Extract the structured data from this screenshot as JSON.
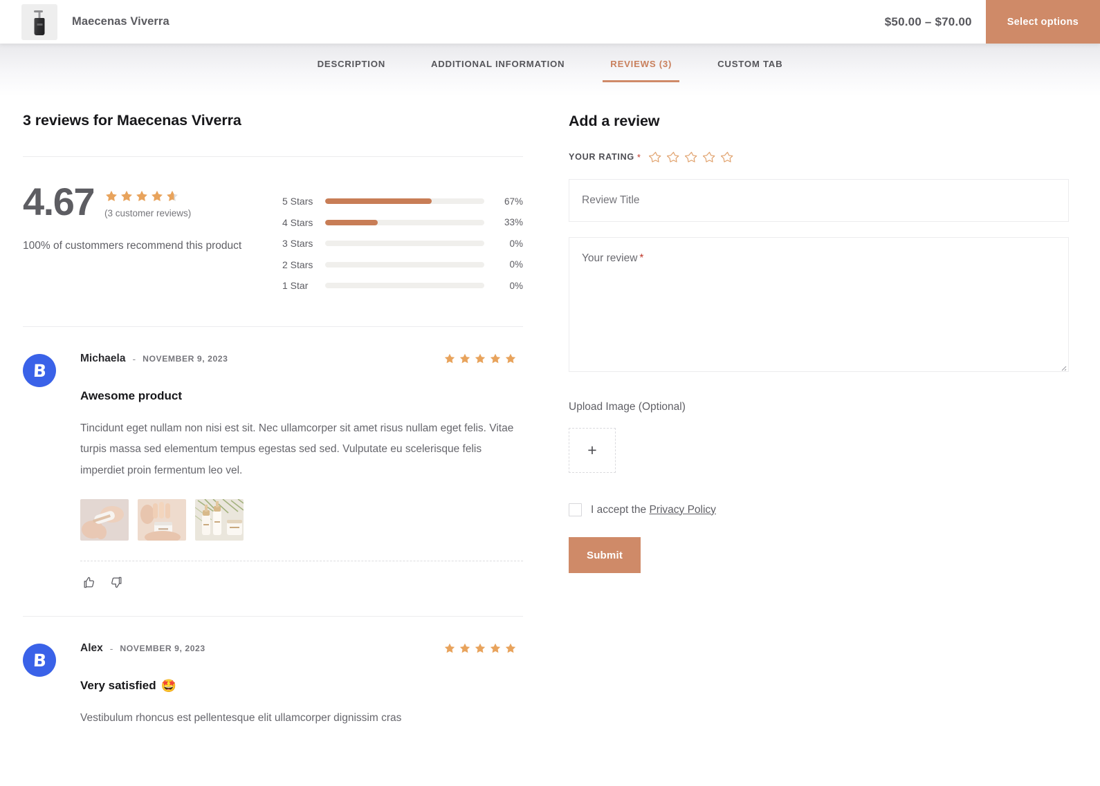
{
  "header": {
    "product_title": "Maecenas Viverra",
    "price_range": "$50.00 – $70.00",
    "select_options_label": "Select options",
    "thumbnail_icon": "product-bottle-image"
  },
  "tabs": [
    {
      "label": "DESCRIPTION",
      "active": false
    },
    {
      "label": "ADDITIONAL INFORMATION",
      "active": false
    },
    {
      "label": "REVIEWS (3)",
      "active": true
    },
    {
      "label": "CUSTOM TAB",
      "active": false
    }
  ],
  "reviews_panel": {
    "heading": "3 reviews for Maecenas Viverra",
    "summary": {
      "score": "4.67",
      "stars_filled": 4.67,
      "customer_reviews_note": "(3 customer reviews)",
      "recommend_text": "100% of custommers recommend this product"
    },
    "breakdown": [
      {
        "label": "5 Stars",
        "pct_text": "67%",
        "pct": 67
      },
      {
        "label": "4 Stars",
        "pct_text": "33%",
        "pct": 33
      },
      {
        "label": "3 Stars",
        "pct_text": "0%",
        "pct": 0
      },
      {
        "label": "2 Stars",
        "pct_text": "0%",
        "pct": 0
      },
      {
        "label": "1 Star",
        "pct_text": "0%",
        "pct": 0
      }
    ],
    "reviews": [
      {
        "author": "Michaela",
        "separator": "-",
        "date": "NOVEMBER 9, 2023",
        "rating": 5,
        "title": "Awesome product",
        "emoji": "",
        "text": "Tincidunt eget nullam non nisi est sit. Nec ullamcorper sit amet risus nullam eget felis. Vitae turpis massa sed elementum tempus egestas sed sed. Vulputate eu scelerisque felis imperdiet proin fermentum leo vel.",
        "photos": [
          "review-photo-hand-bottle",
          "review-photo-hand-jar",
          "review-photo-products-palm"
        ],
        "avatar_letter": "B",
        "avatar_color": "#3a62e8",
        "actions": [
          "thumbs-up-icon",
          "thumbs-down-icon"
        ]
      },
      {
        "author": "Alex",
        "separator": "-",
        "date": "NOVEMBER 9, 2023",
        "rating": 5,
        "title": "Very satisfied",
        "emoji": "🤩",
        "text": "Vestibulum rhoncus est pellentesque elit ullamcorper dignissim cras",
        "photos": [],
        "avatar_letter": "B",
        "avatar_color": "#3a62e8",
        "actions": []
      }
    ]
  },
  "add_review": {
    "heading": "Add a review",
    "rating_label": "YOUR RATING",
    "required_mark": "*",
    "rating_stars_count": 5,
    "rating_value": 0,
    "title_placeholder": "Review Title",
    "title_value": "",
    "review_label": "Your review",
    "review_value": "",
    "upload_label": "Upload Image (Optional)",
    "upload_plus": "+",
    "privacy_prefix": "I accept the ",
    "privacy_link": "Privacy Policy",
    "privacy_checked": false,
    "submit_label": "Submit"
  },
  "colors": {
    "accent": "#cf8a68",
    "bar_fill": "#c87d56",
    "star": "#e8a35c",
    "avatar_blue": "#3a62e8",
    "required_red": "#c0392b"
  }
}
